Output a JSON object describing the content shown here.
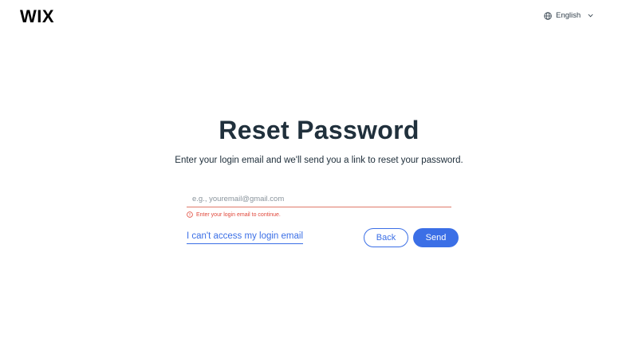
{
  "header": {
    "logo_text": "WIX",
    "language": "English"
  },
  "main": {
    "title": "Reset Password",
    "subtitle": "Enter your login email and we'll send you a link to reset your password.",
    "email": {
      "value": "",
      "placeholder": "e.g., youremail@gmail.com"
    },
    "error_message": "Enter your login email to continue.",
    "cant_access_link": "I can't access my login email",
    "back_label": "Back",
    "send_label": "Send"
  },
  "colors": {
    "accent": "#3b6fe6",
    "error": "#e0473a",
    "text": "#20303c"
  },
  "icons": {
    "language": "globe-icon",
    "dropdown": "chevron-down-icon",
    "error": "alert-circle-icon"
  }
}
